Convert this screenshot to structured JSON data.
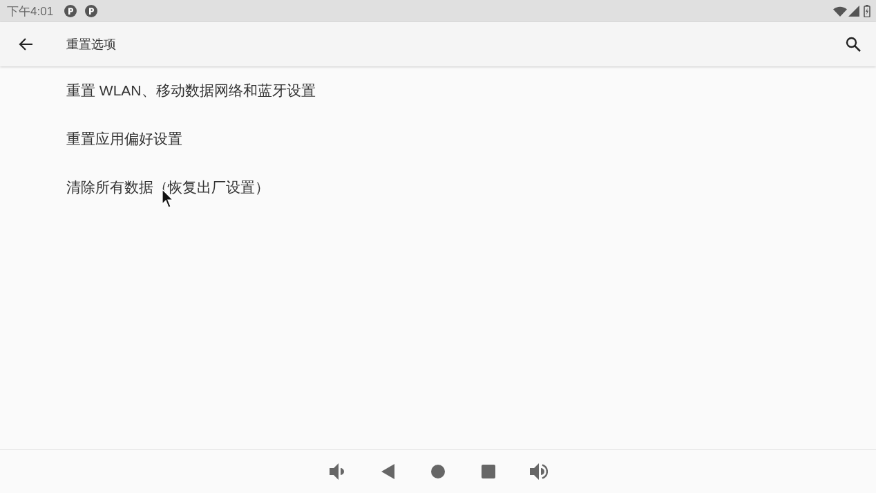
{
  "status_bar": {
    "time": "下午4:01"
  },
  "app_bar": {
    "title": "重置选项"
  },
  "items": [
    {
      "label": "重置 WLAN、移动数据网络和蓝牙设置"
    },
    {
      "label": "重置应用偏好设置"
    },
    {
      "label": "清除所有数据（恢复出厂设置）"
    }
  ]
}
